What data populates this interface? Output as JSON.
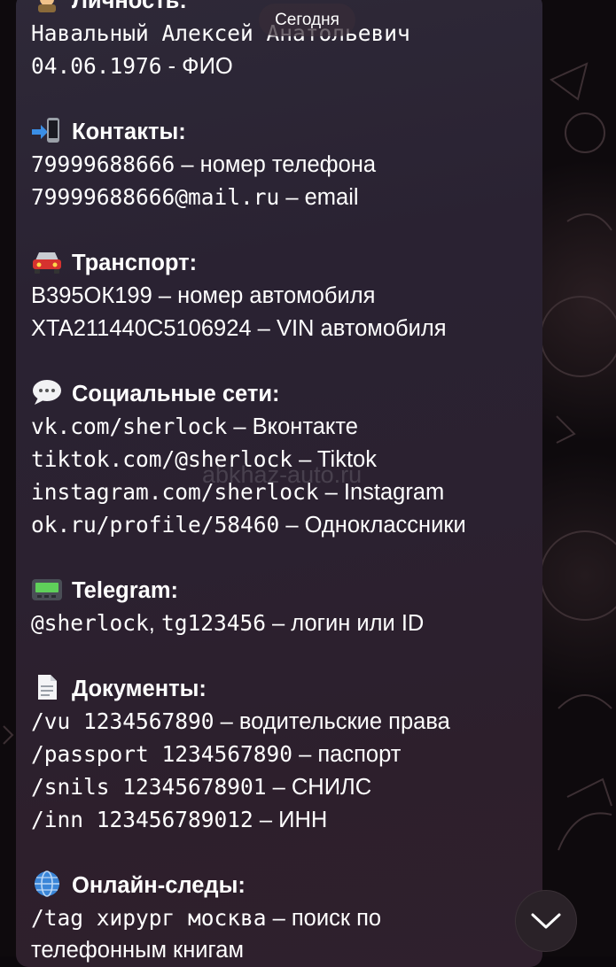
{
  "date_separator": "Сегодня",
  "watermark": "abkhaz-auto.ru",
  "sections": {
    "person": {
      "icon": "detective-icon",
      "title": "Личность:",
      "name_line": "Навальный Алексей Анатольевич",
      "dob": "04.06.1976",
      "dob_suffix": " - ФИО"
    },
    "contacts": {
      "icon": "mobile-arrow-icon",
      "title": "Контакты:",
      "phone": "79999688666",
      "phone_desc": " – номер телефона",
      "email": "79999688666@mail.ru",
      "email_desc": " – email"
    },
    "transport": {
      "icon": "car-icon",
      "title": "Транспорт:",
      "plate": "В395ОК199",
      "plate_desc": " – номер автомобиля",
      "vin": "XTA211440C5106924",
      "vin_desc": " – VIN автомобиля"
    },
    "social": {
      "icon": "speech-bubble-icon",
      "title": "Социальные сети:",
      "items": [
        {
          "value": "vk.com/sherlock",
          "desc": " – Вконтакте"
        },
        {
          "value": "tiktok.com/@sherlock",
          "desc": " – Tiktok"
        },
        {
          "value": "instagram.com/sherlock",
          "desc": " – Instagram"
        },
        {
          "value": "ok.ru/profile/58460",
          "desc": " – Одноклассники"
        }
      ]
    },
    "telegram": {
      "icon": "pager-icon",
      "title": "Telegram:",
      "value_1": "@sherlock",
      "value_sep": ", ",
      "value_2": "tg123456",
      "desc": " – логин или ID"
    },
    "documents": {
      "icon": "document-icon",
      "title": "Документы:",
      "items": [
        {
          "value": "/vu 1234567890",
          "desc": " – водительские права"
        },
        {
          "value": "/passport 1234567890",
          "desc": " – паспорт"
        },
        {
          "value": "/snils 12345678901",
          "desc": " – СНИЛС"
        },
        {
          "value": "/inn 123456789012",
          "desc": " – ИНН"
        }
      ]
    },
    "online": {
      "icon": "globe-icon",
      "title": "Онлайн-следы:",
      "cmd": "/tag хирург москва",
      "desc": " – поиск по",
      "desc_cont": "телефонным книгам"
    }
  },
  "colors": {
    "text": "#ffffff",
    "bubble": "#2b2232",
    "background": "#0e0a0d"
  }
}
